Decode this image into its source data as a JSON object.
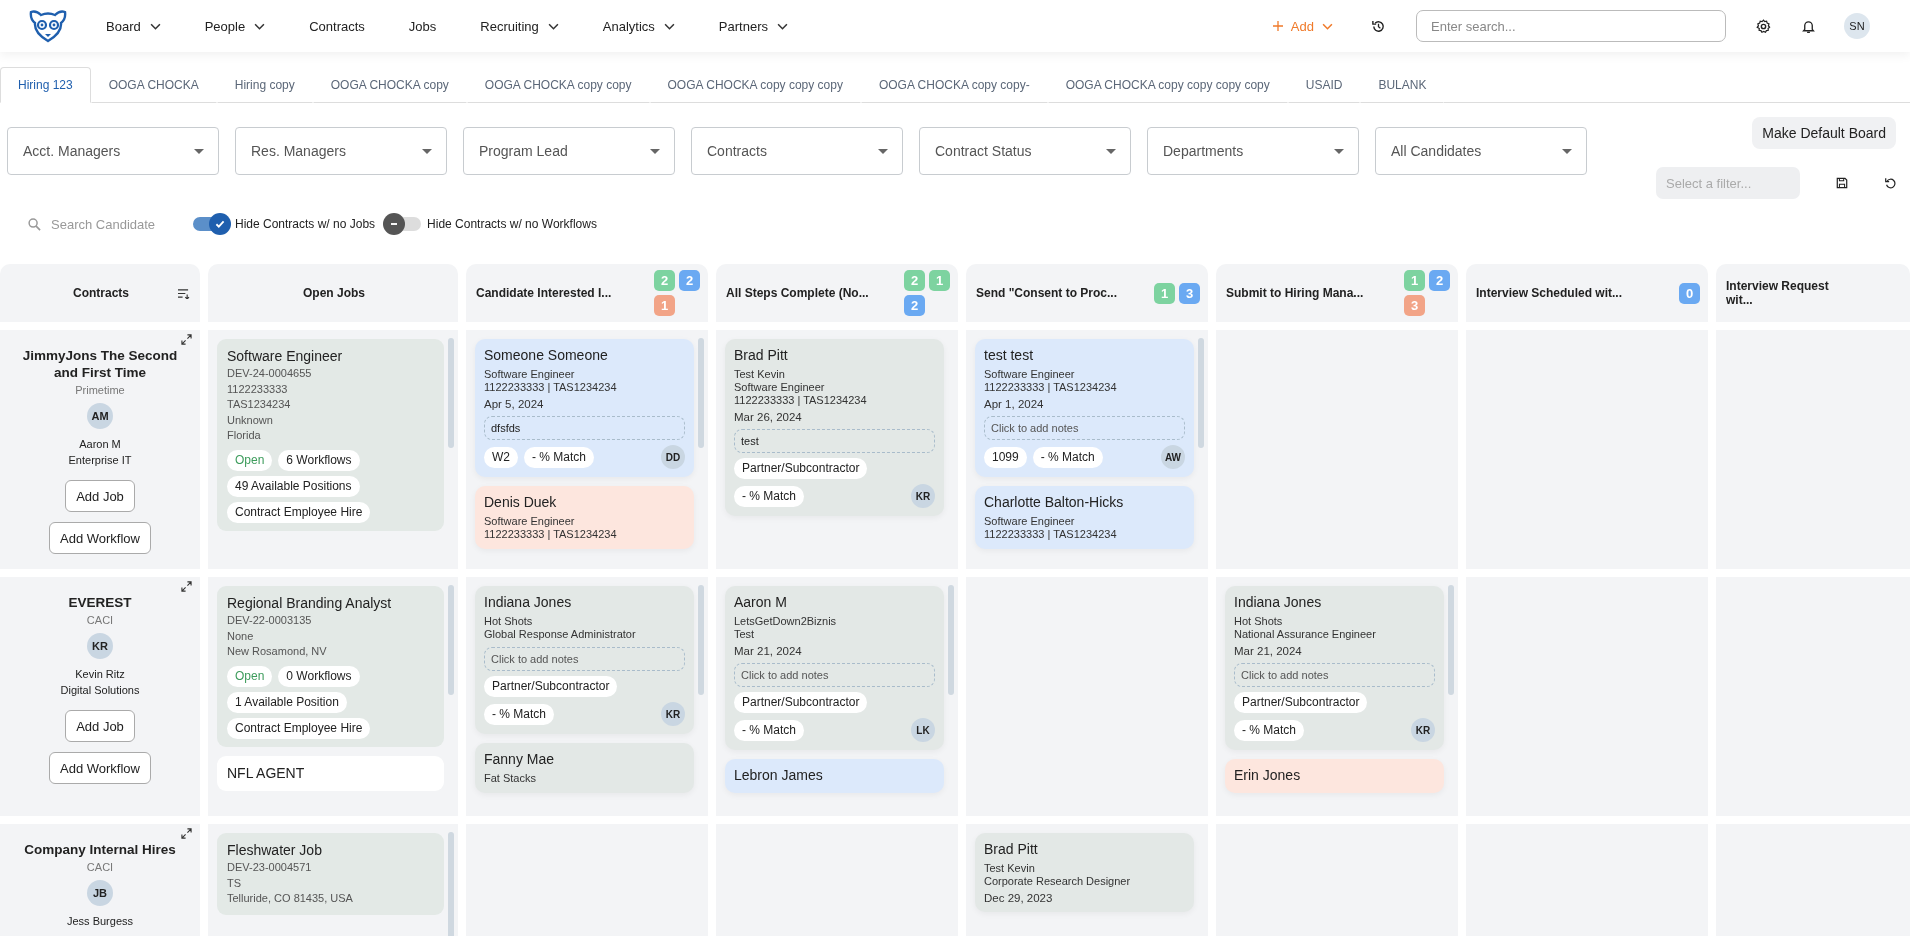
{
  "nav": {
    "items": [
      {
        "label": "Board",
        "dropdown": true
      },
      {
        "label": "People",
        "dropdown": true
      },
      {
        "label": "Contracts",
        "dropdown": false
      },
      {
        "label": "Jobs",
        "dropdown": false
      },
      {
        "label": "Recruiting",
        "dropdown": true
      },
      {
        "label": "Analytics",
        "dropdown": true
      },
      {
        "label": "Partners",
        "dropdown": true
      }
    ],
    "add_label": "Add",
    "search_placeholder": "Enter search...",
    "avatar": "SN"
  },
  "tabs": [
    {
      "label": "Hiring 123",
      "selected": true
    },
    {
      "label": "OOGA CHOCKA",
      "selected": false
    },
    {
      "label": "Hiring copy",
      "selected": false
    },
    {
      "label": "OOGA CHOCKA copy",
      "selected": false
    },
    {
      "label": "OOGA CHOCKA copy copy",
      "selected": false
    },
    {
      "label": "OOGA CHOCKA copy copy copy",
      "selected": false
    },
    {
      "label": "OOGA CHOCKA copy copy-",
      "selected": false
    },
    {
      "label": "OOGA CHOCKA copy copy copy copy",
      "selected": false
    },
    {
      "label": "USAID",
      "selected": false
    },
    {
      "label": "BULANK",
      "selected": false
    }
  ],
  "filters": [
    "Acct. Managers",
    "Res. Managers",
    "Program Lead",
    "Contracts",
    "Contract Status",
    "Departments",
    "All Candidates"
  ],
  "make_default": "Make Default Board",
  "select_filter_placeholder": "Select a filter...",
  "candidate_search_placeholder": "Search Candidate",
  "toggles": [
    {
      "label": "Hide Contracts w/ no Jobs",
      "on": true
    },
    {
      "label": "Hide Contracts w/ no Workflows",
      "on": false
    }
  ],
  "board": {
    "contracts_header": "Contracts",
    "jobs_header": "Open Jobs",
    "stages": [
      {
        "title": "Candidate Interested I...",
        "counts": [
          {
            "value": "2",
            "color": "#7dd3a0"
          },
          {
            "value": "2",
            "color": "#6aa9f2"
          },
          {
            "value": "1",
            "color": "#f2a487"
          }
        ]
      },
      {
        "title": "All Steps Complete (No...",
        "counts": [
          {
            "value": "2",
            "color": "#7dd3a0"
          },
          {
            "value": "1",
            "color": "#7dd3a0"
          },
          {
            "value": "2",
            "color": "#6aa9f2"
          }
        ]
      },
      {
        "title": "Send \"Consent to Proc...",
        "counts": [
          {
            "value": "1",
            "color": "#7dd3a0"
          },
          {
            "value": "3",
            "color": "#6aa9f2"
          }
        ]
      },
      {
        "title": "Submit to Hiring Mana...",
        "counts": [
          {
            "value": "1",
            "color": "#7dd3a0"
          },
          {
            "value": "2",
            "color": "#6aa9f2"
          },
          {
            "value": "3",
            "color": "#f2a487"
          }
        ]
      },
      {
        "title": "Interview Scheduled wit...",
        "counts": [
          {
            "value": "0",
            "color": "#6aa9f2"
          }
        ]
      },
      {
        "title": "Interview Request wit..."
      }
    ],
    "rows": [
      {
        "contract": {
          "name": "JimmyJons The Second and First Time",
          "client": "Primetime",
          "initials": "AM",
          "manager": "Aaron M",
          "department": "Enterprise IT",
          "buttons": [
            "Add Job",
            "Add Workflow"
          ]
        },
        "jobs": [
          {
            "title": "Software Engineer",
            "color": "#e3e9e6",
            "lines": [
              "DEV-24-0004655",
              "1122233333",
              "TAS1234234",
              "Unknown",
              "Florida"
            ],
            "status": "Open",
            "workflows": "6 Workflows",
            "positions": "49 Available Positions",
            "type": "Contract Employee Hire"
          }
        ],
        "stage_cells": [
          [
            {
              "name": "Someone Someone",
              "color": "#dce9fb",
              "lines": [
                "Software Engineer",
                "1122233333 | TAS1234234"
              ],
              "date": "Apr 5, 2024",
              "notes": "dfsfds",
              "tags": [
                "W2",
                "- % Match"
              ],
              "initials": "DD"
            },
            {
              "name": "Denis Duek",
              "color": "#fde6de",
              "lines": [
                "Software Engineer",
                "1122233333 | TAS1234234"
              ]
            }
          ],
          [
            {
              "name": "Brad Pitt",
              "color": "#e3e8e6",
              "lines": [
                "Test Kevin",
                "Software Engineer",
                "1122233333 | TAS1234234"
              ],
              "date": "Mar 26, 2024",
              "notes": "test",
              "tags": [
                "Partner/Subcontractor",
                "- % Match"
              ],
              "initials": "KR"
            }
          ],
          [
            {
              "name": "test test",
              "color": "#dce9fb",
              "lines": [
                "Software Engineer",
                "1122233333 | TAS1234234"
              ],
              "date": "Apr 1, 2024",
              "notes_placeholder": "Click to add notes",
              "tags": [
                "1099",
                "- % Match"
              ],
              "initials": "AW"
            },
            {
              "name": "Charlotte Balton-Hicks",
              "color": "#dce9fb",
              "lines": [
                "Software Engineer",
                "1122233333 | TAS1234234"
              ]
            }
          ],
          [],
          [],
          []
        ]
      },
      {
        "contract": {
          "name": "EVEREST",
          "client": "CACI",
          "initials": "KR",
          "manager": "Kevin Ritz",
          "department": "Digital Solutions",
          "buttons": [
            "Add Job",
            "Add Workflow"
          ]
        },
        "jobs": [
          {
            "title": "Regional Branding Analyst",
            "color": "#e3e9e6",
            "lines": [
              "DEV-22-0003135",
              "None",
              "New Rosamond, NV"
            ],
            "status": "Open",
            "workflows": "0 Workflows",
            "positions": "1 Available Position",
            "type": "Contract Employee Hire"
          },
          {
            "title": "NFL AGENT",
            "color": "#ffffff"
          }
        ],
        "stage_cells": [
          [
            {
              "name": "Indiana Jones",
              "color": "#e3e8e6",
              "lines": [
                "Hot Shots",
                "Global Response Administrator"
              ],
              "notes_placeholder": "Click to add notes",
              "tags": [
                "Partner/Subcontractor",
                "- % Match"
              ],
              "initials": "KR"
            },
            {
              "name": "Fanny Mae",
              "color": "#e3e8e6",
              "lines": [
                "Fat Stacks"
              ]
            }
          ],
          [
            {
              "name": "Aaron M",
              "color": "#e3e8e6",
              "lines": [
                "LetsGetDown2Biznis",
                "Test"
              ],
              "date": "Mar 21, 2024",
              "notes_placeholder": "Click to add notes",
              "tags": [
                "Partner/Subcontractor",
                "- % Match"
              ],
              "initials": "LK"
            },
            {
              "name": "Lebron James",
              "color": "#dce9fb"
            }
          ],
          [],
          [
            {
              "name": "Indiana Jones",
              "color": "#e3e8e6",
              "lines": [
                "Hot Shots",
                "National Assurance Engineer"
              ],
              "date": "Mar 21, 2024",
              "notes_placeholder": "Click to add notes",
              "tags": [
                "Partner/Subcontractor",
                "- % Match"
              ],
              "initials": "KR"
            },
            {
              "name": "Erin Jones",
              "color": "#fde6de"
            }
          ],
          [],
          []
        ]
      },
      {
        "contract": {
          "name": "Company Internal Hires",
          "client": "CACI",
          "initials": "JB",
          "manager": "Jess Burgess"
        },
        "jobs": [
          {
            "title": "Fleshwater Job",
            "color": "#e3e9e6",
            "lines": [
              "DEV-23-0004571",
              "TS",
              "Telluride, CO 81435, USA"
            ]
          }
        ],
        "stage_cells": [
          [],
          [],
          [
            {
              "name": "Brad Pitt",
              "color": "#e3e8e6",
              "lines": [
                "Test Kevin",
                "Corporate Research Designer"
              ],
              "date": "Dec 29, 2023"
            }
          ],
          [],
          [],
          []
        ]
      }
    ]
  }
}
